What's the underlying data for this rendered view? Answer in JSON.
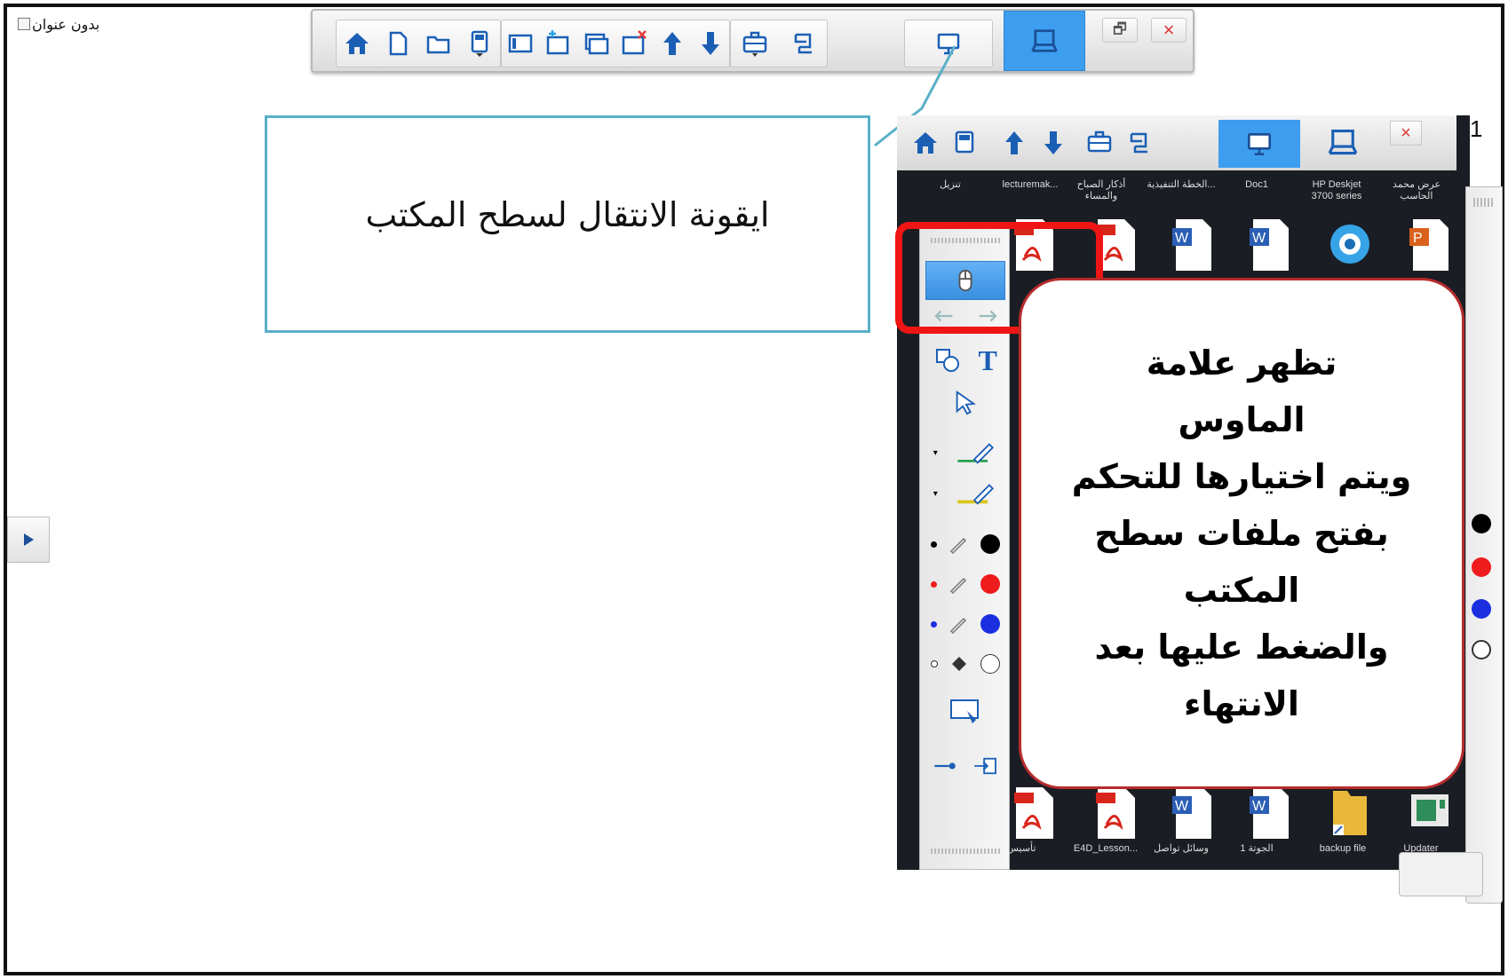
{
  "document": {
    "title": "بدون عنوان",
    "page_number": "1"
  },
  "main_toolbar": {
    "buttons": [
      "home-icon",
      "new-page-icon",
      "open-folder-icon",
      "save-icon",
      "page-view-icon",
      "add-page-icon",
      "duplicate-page-icon",
      "delete-page-icon",
      "up-arrow-icon",
      "down-arrow-icon",
      "toolbox-icon",
      "return-icon",
      "desktop-icon",
      "board-mode-icon"
    ],
    "restore_label": "🗗",
    "close_label": "×",
    "active_color": "#3d9ef0"
  },
  "callout": {
    "text": "ايقونة الانتقال لسطح المكتب",
    "border_color": "#5ab0c8"
  },
  "inner_screen": {
    "close_label": "×",
    "top_labels": [
      "تنزيل",
      "lecturemak...",
      "أذكار الصباح والمساء",
      "الخطة التنفيذية...",
      "Doc1",
      "HP Deskjet 3700 series",
      "عرض محمد الحاسب"
    ],
    "bottom_labels": [
      "تأسيس",
      "E4D_Lesson...",
      "وسائل تواصل",
      "الجوتة 1",
      "backup file",
      "Updater"
    ],
    "text_tool_label": "T"
  },
  "highlight": {
    "color": "#ef1515"
  },
  "info_bubble": {
    "lines": [
      "تظهر علامة",
      "الماوس",
      "ويتم اختيارها للتحكم",
      "بفتح ملفات سطح",
      "المكتب",
      "والضغط عليها بعد",
      "الانتهاء"
    ],
    "border_color": "#b72c2c"
  }
}
